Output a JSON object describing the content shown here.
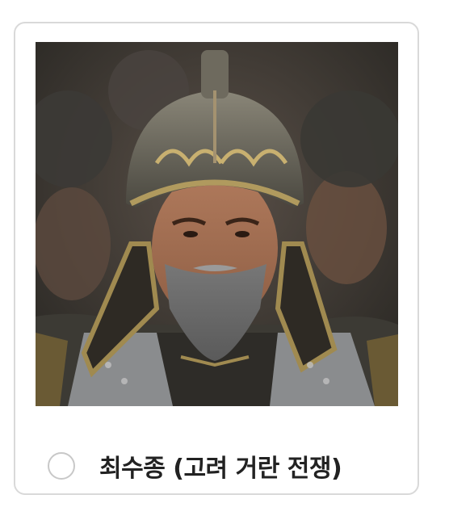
{
  "option": {
    "label": "최수종 (고려 거란 전쟁)",
    "selected": false
  },
  "photo": {
    "icon": "portrait-image"
  },
  "colors": {
    "card_border": "#d9d9d9",
    "radio_border": "#c8c8c8",
    "label_text": "#222222"
  }
}
